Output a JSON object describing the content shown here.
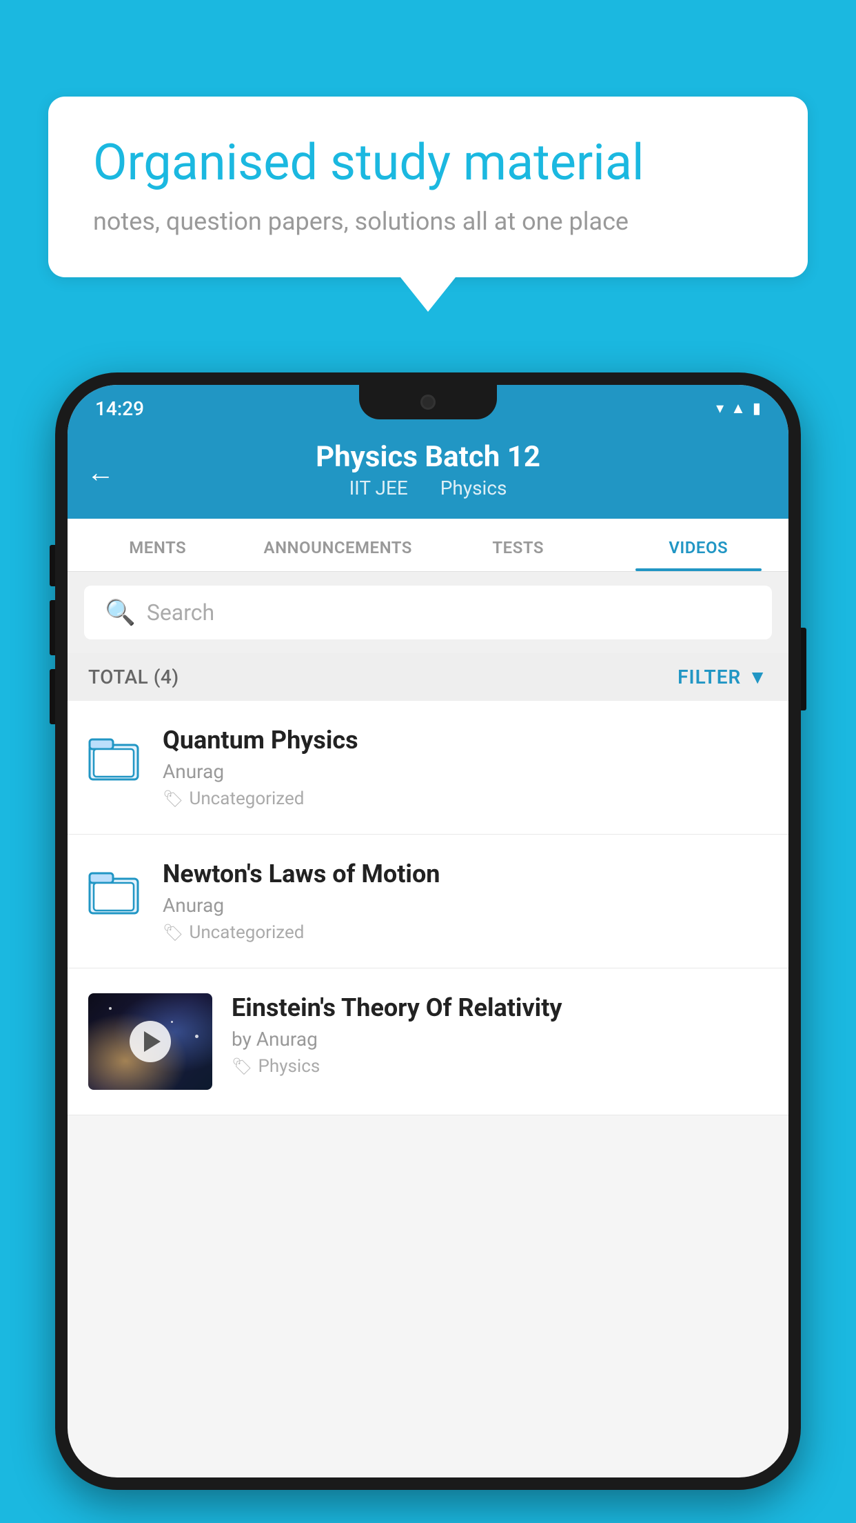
{
  "background_color": "#1bb8e0",
  "speech_bubble": {
    "title": "Organised study material",
    "subtitle": "notes, question papers, solutions all at one place"
  },
  "phone": {
    "status_bar": {
      "time": "14:29",
      "icons": [
        "wifi",
        "signal",
        "battery"
      ]
    },
    "header": {
      "back_label": "←",
      "title": "Physics Batch 12",
      "subtitle_1": "IIT JEE",
      "subtitle_2": "Physics"
    },
    "tabs": [
      {
        "label": "MENTS",
        "active": false
      },
      {
        "label": "ANNOUNCEMENTS",
        "active": false
      },
      {
        "label": "TESTS",
        "active": false
      },
      {
        "label": "VIDEOS",
        "active": true
      }
    ],
    "search": {
      "placeholder": "Search"
    },
    "filter_bar": {
      "total_label": "TOTAL (4)",
      "filter_label": "FILTER"
    },
    "video_list": [
      {
        "title": "Quantum Physics",
        "author": "Anurag",
        "tag": "Uncategorized",
        "has_thumbnail": false
      },
      {
        "title": "Newton's Laws of Motion",
        "author": "Anurag",
        "tag": "Uncategorized",
        "has_thumbnail": false
      },
      {
        "title": "Einstein's Theory Of Relativity",
        "author": "by Anurag",
        "tag": "Physics",
        "has_thumbnail": true
      }
    ]
  }
}
